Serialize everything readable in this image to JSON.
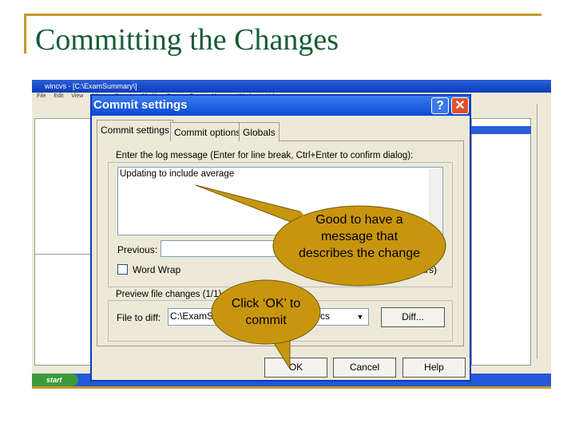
{
  "slide": {
    "title": "Committing the Changes",
    "accent": "#c09a2a",
    "title_color": "#175c34"
  },
  "app": {
    "window_title": "wincvs - [C:\\ExamSummary\\]",
    "menu": "File Edit View Admin Remote Modify Query Trace Macros Window Help",
    "taskbar_start": "start"
  },
  "dialog": {
    "title": "Commit settings",
    "help_label": "?",
    "close_label": "✕",
    "tabs": [
      {
        "label": "Commit settings",
        "active": true
      },
      {
        "label": "Commit options"
      },
      {
        "label": "Globals"
      }
    ],
    "log_group": "Enter the log message (Enter for line break, Ctrl+Enter to confirm dialog):",
    "log_message": "Updating to include average",
    "previous_label": "Previous:",
    "previous_value": "",
    "word_wrap_label": "Word Wrap",
    "word_wrap_checked": false,
    "char_count": "(27 chars)",
    "preview_group": "Preview file changes (1/1)",
    "file_to_diff_label": "File to diff:",
    "file_to_diff_prefix": "C:\\ExamS",
    "file_to_diff_suffix": "cs",
    "diff_button": "Diff...",
    "ok_button": "OK",
    "cancel_button": "Cancel",
    "help_button": "Help"
  },
  "callouts": [
    {
      "text": "Good to have a message that describes the change",
      "color": "#c8960e"
    },
    {
      "text": "Click ‘OK’ to commit",
      "color": "#c8960e"
    }
  ]
}
